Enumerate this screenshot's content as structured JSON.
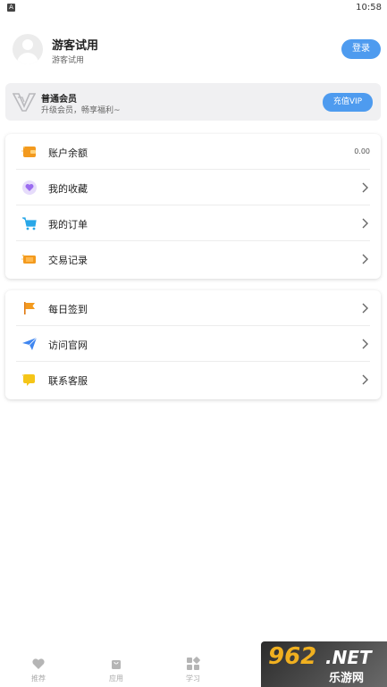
{
  "status_bar": {
    "app_badge": "A",
    "time": "10:58"
  },
  "profile": {
    "name": "游客试用",
    "subtitle": "游客试用",
    "login_label": "登录"
  },
  "vip": {
    "title": "普通会员",
    "subtitle": "升级会员，畅享福利~",
    "button_label": "充值VIP"
  },
  "account_section": {
    "items": [
      {
        "label": "账户余额",
        "value": "0.00",
        "icon": "wallet-icon"
      },
      {
        "label": "我的收藏",
        "icon": "heart-icon"
      },
      {
        "label": "我的订单",
        "icon": "cart-icon"
      },
      {
        "label": "交易记录",
        "icon": "ticket-icon"
      }
    ]
  },
  "service_section": {
    "items": [
      {
        "label": "每日签到",
        "icon": "flag-icon"
      },
      {
        "label": "访问官网",
        "icon": "paper-plane-icon"
      },
      {
        "label": "联系客服",
        "icon": "chat-icon"
      }
    ]
  },
  "tabbar": {
    "items": [
      {
        "label": "推荐",
        "icon": "heart-icon"
      },
      {
        "label": "应用",
        "icon": "bag-icon"
      },
      {
        "label": "学习",
        "icon": "grid-icon"
      }
    ]
  },
  "watermark": {
    "big": "962",
    "net": ".NET",
    "cn": "乐游网"
  },
  "colors": {
    "accent": "#4e9bef",
    "orange": "#f39a1e",
    "purple": "#9b6cf0",
    "card_bg": "#f0f0f2"
  }
}
